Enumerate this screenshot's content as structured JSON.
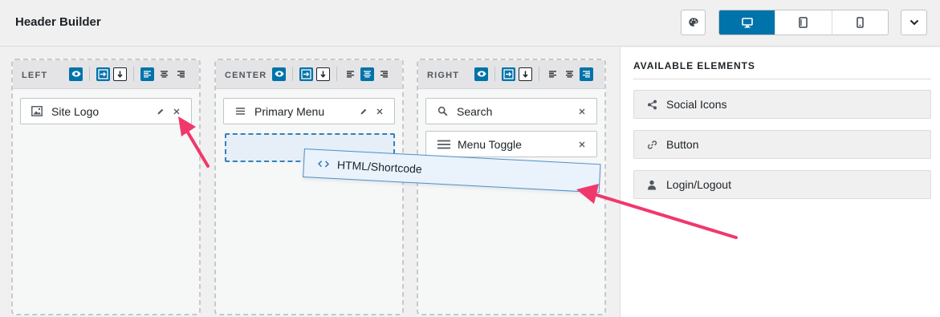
{
  "header": {
    "title": "Header Builder",
    "palette_icon": "palette-icon",
    "devices": [
      {
        "name": "desktop",
        "icon": "desktop-icon",
        "active": true
      },
      {
        "name": "tablet",
        "icon": "tablet-icon",
        "active": false
      },
      {
        "name": "mobile",
        "icon": "mobile-icon",
        "active": false
      }
    ],
    "collapse_icon": "chevron-down-icon"
  },
  "columns": [
    {
      "label": "LEFT",
      "elements": [
        {
          "label": "Site Logo",
          "icon": "image-icon",
          "editable": true
        }
      ]
    },
    {
      "label": "CENTER",
      "elements": [
        {
          "label": "Primary Menu",
          "icon": "menu-icon",
          "editable": true
        }
      ]
    },
    {
      "label": "RIGHT",
      "elements": [
        {
          "label": "Search",
          "icon": "search-icon",
          "editable": false
        },
        {
          "label": "Menu Toggle",
          "icon": "hamburger-icon",
          "editable": false
        }
      ]
    }
  ],
  "dragging": {
    "label": "HTML/Shortcode",
    "icon": "code-icon"
  },
  "sidebar": {
    "title": "AVAILABLE ELEMENTS",
    "items": [
      {
        "label": "Social Icons",
        "icon": "share-icon"
      },
      {
        "label": "Button",
        "icon": "link-icon"
      },
      {
        "label": "Login/Logout",
        "icon": "user-icon"
      }
    ]
  },
  "colors": {
    "accent": "#0073aa",
    "annotation_arrow": "#f0386b",
    "dropzone_border": "#3580bd"
  }
}
